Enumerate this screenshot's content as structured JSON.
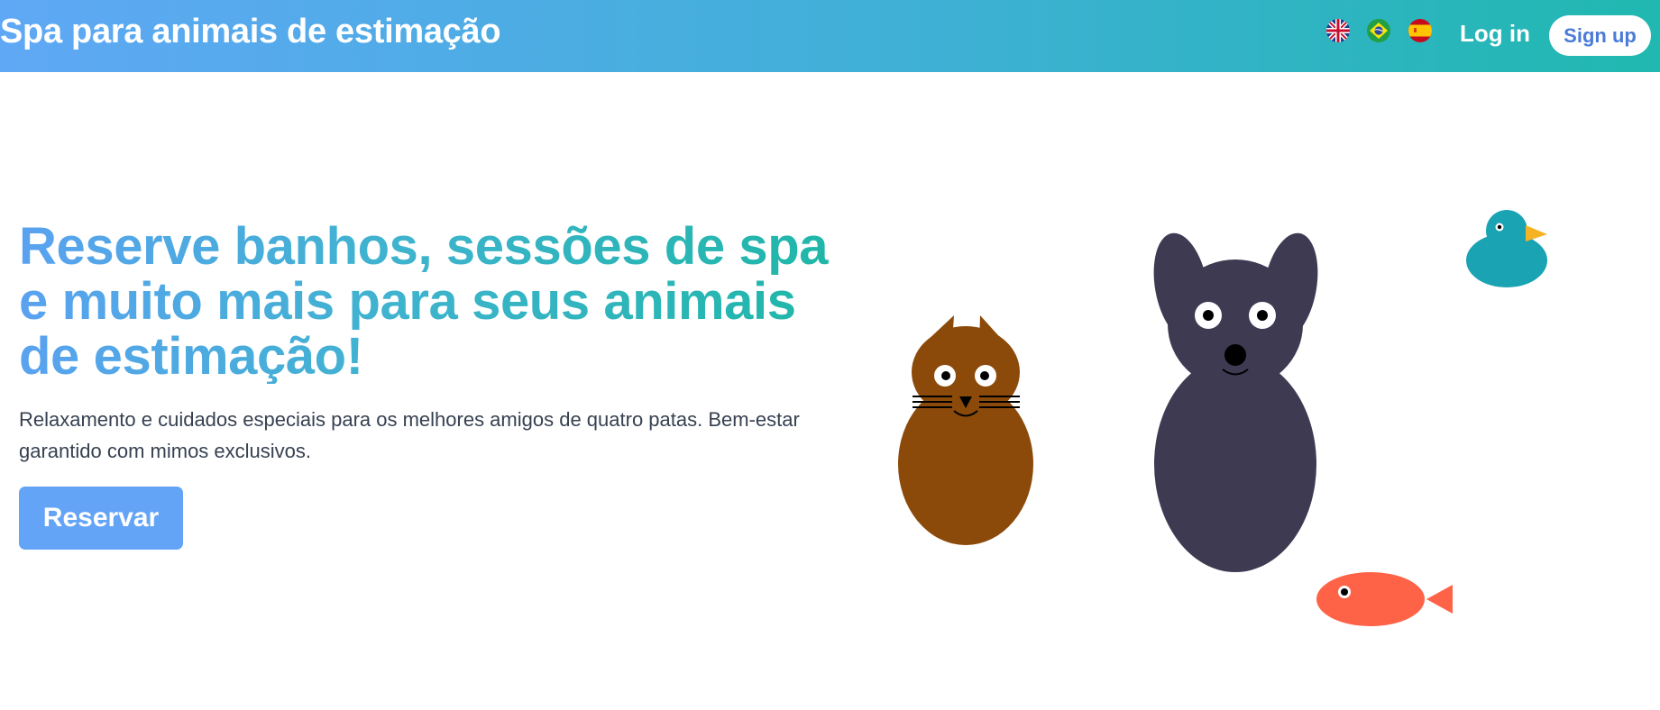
{
  "header": {
    "brand": "Spa para animais de estimação",
    "languages": [
      {
        "code": "en",
        "icon": "uk-flag-icon"
      },
      {
        "code": "pt-BR",
        "icon": "brazil-flag-icon"
      },
      {
        "code": "es",
        "icon": "spain-flag-icon"
      }
    ],
    "login_label": "Log in",
    "signup_label": "Sign up"
  },
  "hero": {
    "title": "Reserve banhos, sessões de spa e muito mais para seus animais de estimação!",
    "subtitle": "Relaxamento e cuidados especiais para os melhores amigos de quatro patas. Bem-estar garantido com mimos exclusivos.",
    "cta_label": "Reservar"
  },
  "illustration": {
    "animals": [
      "cat",
      "dog",
      "duck",
      "fish"
    ]
  },
  "colors": {
    "header_gradient_start": "#5fa8f5",
    "header_gradient_end": "#20b8b0",
    "cta": "#63a4f7",
    "signup_text": "#4a7bd6",
    "cat": "#8b4a0a",
    "dog": "#3d3a52",
    "duck": "#1aa3b3",
    "duck_beak": "#f5b324",
    "fish": "#ff6347"
  }
}
